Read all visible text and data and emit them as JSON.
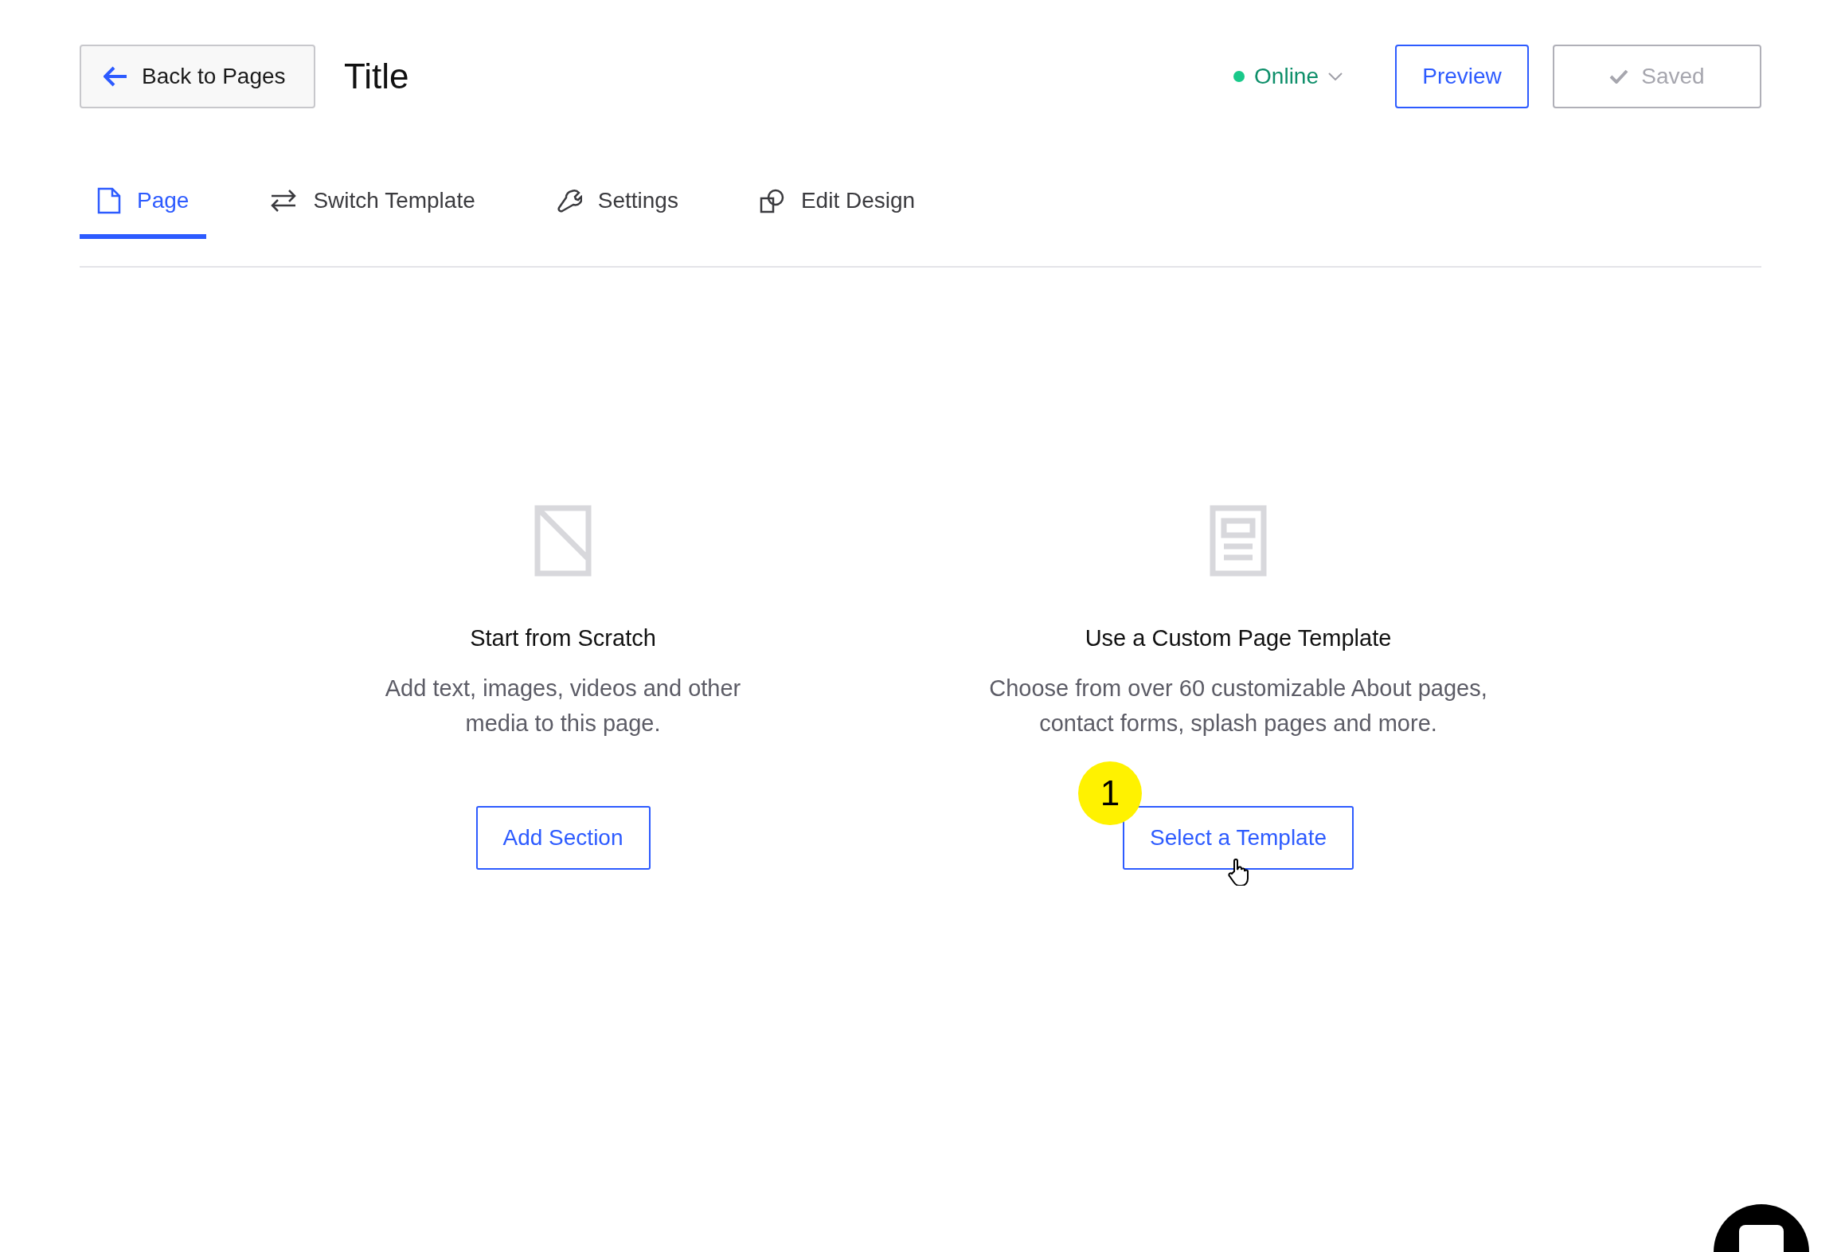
{
  "header": {
    "back_button": "Back to Pages",
    "title": "Title",
    "status": {
      "label": "Online"
    },
    "preview_button": "Preview",
    "saved_button": {
      "label": "Saved",
      "disabled": true
    }
  },
  "tabs": [
    {
      "label": "Page",
      "kind": "page",
      "selected": true
    },
    {
      "label": "Switch Template",
      "kind": "switch",
      "selected": false
    },
    {
      "label": "Settings",
      "kind": "wrench",
      "selected": false
    },
    {
      "label": "Edit Design",
      "kind": "shapes",
      "selected": false
    }
  ],
  "options": [
    {
      "kind": "blank",
      "heading": "Start from Scratch",
      "description": "Add text, images, videos and other media to this page.",
      "button": "Add Section"
    },
    {
      "kind": "template",
      "heading": "Use a Custom Page Template",
      "description": "Choose from over 60 customizable About pages, contact forms, splash pages and more.",
      "button": "Select a Template",
      "step_badge": "1"
    }
  ]
}
